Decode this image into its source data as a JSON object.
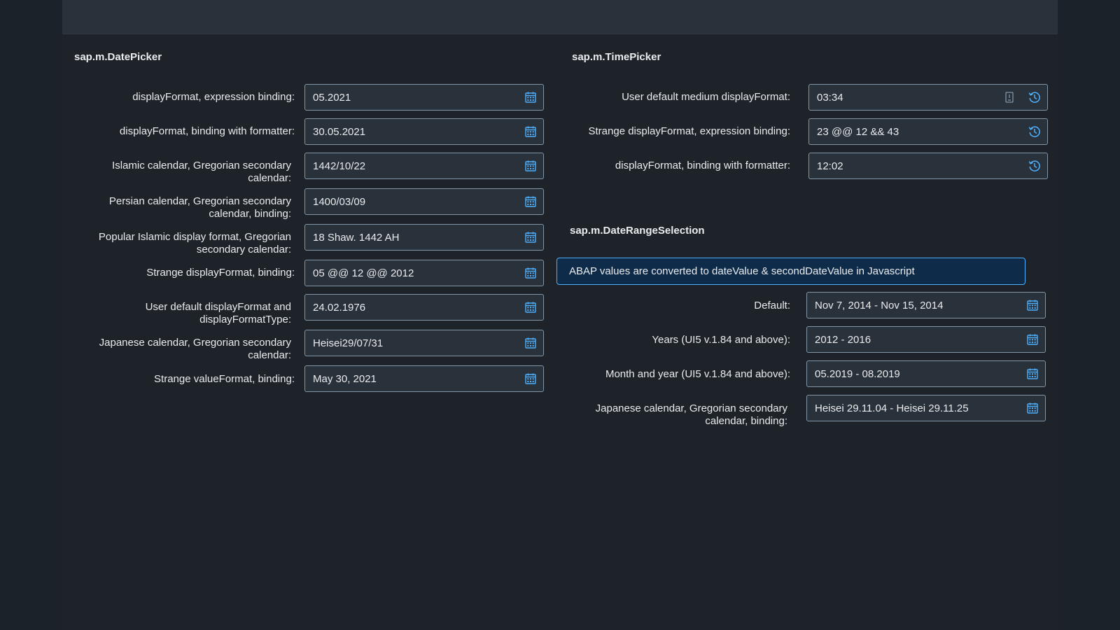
{
  "datepicker": {
    "title": "sap.m.DatePicker",
    "fields": [
      {
        "label": "displayFormat, expression binding:",
        "value": "05.2021"
      },
      {
        "label": "displayFormat, binding with formatter:",
        "value": "30.05.2021"
      },
      {
        "label": "Islamic calendar, Gregorian secondary calendar:",
        "value": "1442/10/22"
      },
      {
        "label": "Persian calendar, Gregorian secondary calendar, binding:",
        "value": "1400/03/09"
      },
      {
        "label": "Popular Islamic display format, Gregorian secondary calendar:",
        "value": "18 Shaw. 1442 AH"
      },
      {
        "label": "Strange displayFormat, binding:",
        "value": "05 @@ 12 @@ 2012"
      },
      {
        "label": "User default displayFormat and displayFormatType:",
        "value": "24.02.1976"
      },
      {
        "label": "Japanese calendar, Gregorian secondary calendar:",
        "value": "Heisei29/07/31"
      },
      {
        "label": "Strange valueFormat, binding:",
        "value": "May 30, 2021"
      }
    ]
  },
  "timepicker": {
    "title": "sap.m.TimePicker",
    "fields": [
      {
        "label": "User default medium displayFormat:",
        "value": "03:34"
      },
      {
        "label": "Strange displayFormat, expression binding:",
        "value": "23 @@ 12 && 43"
      },
      {
        "label": "displayFormat, binding with formatter:",
        "value": "12:02"
      }
    ]
  },
  "daterange": {
    "title": "sap.m.DateRangeSelection",
    "info_strip": "ABAP values are converted to dateValue & secondDateValue in Javascript",
    "fields": [
      {
        "label": "Default:",
        "value": "Nov 7, 2014 - Nov 15, 2014"
      },
      {
        "label": "Years (UI5 v.1.84 and above):",
        "value": "2012 - 2016"
      },
      {
        "label": "Month and year (UI5 v.1.84 and above):",
        "value": "05.2019 - 08.2019"
      },
      {
        "label": "Japanese calendar, Gregorian secondary calendar, binding:",
        "value": "Heisei 29.11.04 - Heisei 29.11.25"
      }
    ]
  },
  "icons": {
    "calendar": "calendar-icon",
    "time": "time-entry-icon",
    "keyboard": "keyboard-icon"
  },
  "colors": {
    "background": "#1d2329",
    "shellbar": "#29313a",
    "field_border": "#8396a8",
    "icon": "#4db1ff",
    "info_strip_bg": "#0e2b4a",
    "info_strip_border": "#4db1ff"
  }
}
